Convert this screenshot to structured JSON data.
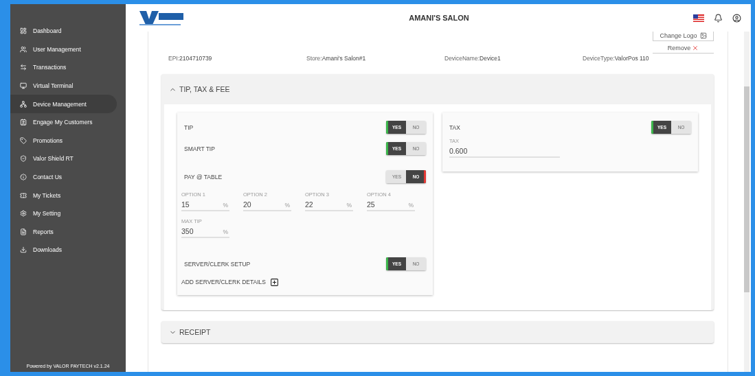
{
  "sidebar": {
    "items": [
      {
        "label": "Dashboard",
        "selected": false
      },
      {
        "label": "User Management",
        "selected": false
      },
      {
        "label": "Transactions",
        "selected": false
      },
      {
        "label": "Virtual Terminal",
        "selected": false
      },
      {
        "label": "Device Management",
        "selected": true
      },
      {
        "label": "Engage My Customers",
        "selected": false
      },
      {
        "label": "Promotions",
        "selected": false
      },
      {
        "label": "Valor Shield RT",
        "selected": false
      },
      {
        "label": "Contact Us",
        "selected": false
      },
      {
        "label": "My Tickets",
        "selected": false
      },
      {
        "label": "My Setting",
        "selected": false
      },
      {
        "label": "Reports",
        "selected": false
      },
      {
        "label": "Downloads",
        "selected": false
      }
    ],
    "footer": "Powered by VALOR PAYTECH v2.1.24"
  },
  "header": {
    "title": "AMANI'S SALON"
  },
  "logo_actions": [
    "Change Logo",
    "Remove"
  ],
  "info": [
    {
      "label": "EPI:",
      "value": "2104710739"
    },
    {
      "label": "Store:",
      "value": "Amani's Salon#1"
    },
    {
      "label": "DeviceName:",
      "value": "Device1"
    },
    {
      "label": "DeviceType:",
      "value": "ValorPos 110"
    }
  ],
  "sections": [
    {
      "title": "TIP, TAX & FEE",
      "expanded": true,
      "tip_card": {
        "toggles": [
          {
            "label": "TIP",
            "options": [
              {
                "label": "YES",
                "selected": true
              },
              {
                "label": "NO",
                "selected": false
              }
            ]
          },
          {
            "label": "SMART TIP",
            "options": [
              {
                "label": "YES",
                "selected": true
              },
              {
                "label": "NO",
                "selected": false
              }
            ]
          },
          {
            "label": "PAY @ TABLE",
            "options": [
              {
                "label": "YES",
                "selected": false
              },
              {
                "label": "NO",
                "selected": true
              }
            ]
          }
        ],
        "options": [
          {
            "label": "OPTION 1",
            "value": "15",
            "unit": "%"
          },
          {
            "label": "OPTION 2",
            "value": "20",
            "unit": "%"
          },
          {
            "label": "OPTION 3",
            "value": "22",
            "unit": "%"
          },
          {
            "label": "OPTION 4",
            "value": "25",
            "unit": "%"
          }
        ],
        "max_tip": {
          "label": "MAX TIP",
          "value": "350",
          "unit": "%"
        },
        "server": {
          "label": "SERVER/CLERK SETUP",
          "options": [
            {
              "label": "YES",
              "selected": true
            },
            {
              "label": "NO",
              "selected": false
            }
          ]
        },
        "add_link": "ADD SERVER/CLERK DETAILS"
      },
      "tax_card": {
        "label": "TAX",
        "options": [
          {
            "label": "YES",
            "selected": true
          },
          {
            "label": "NO",
            "selected": false
          }
        ],
        "field_label": "TAX",
        "value": "0.600"
      }
    },
    {
      "title": "RECEIPT",
      "expanded": false
    }
  ]
}
